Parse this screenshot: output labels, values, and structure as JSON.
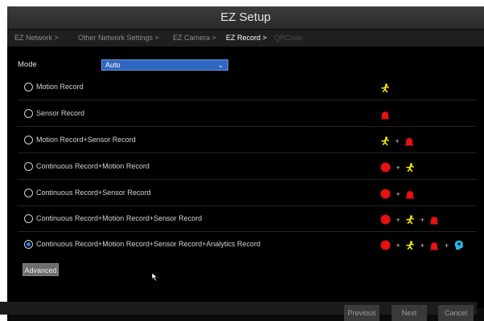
{
  "window": {
    "title": "EZ Setup"
  },
  "breadcrumb": {
    "items": [
      {
        "label": "EZ Network >",
        "state": "visited"
      },
      {
        "label": "Other Network Settings >",
        "state": "visited"
      },
      {
        "label": "EZ Camera >",
        "state": "visited"
      },
      {
        "label": "EZ Record >",
        "state": "active"
      },
      {
        "label": "QRCode",
        "state": "disabled"
      }
    ]
  },
  "mode": {
    "label": "Mode",
    "value": "Auto"
  },
  "options": [
    {
      "label": "Motion Record",
      "selected": false,
      "icons": [
        "motion"
      ]
    },
    {
      "label": "Sensor Record",
      "selected": false,
      "icons": [
        "sensor"
      ]
    },
    {
      "label": "Motion Record+Sensor Record",
      "selected": false,
      "icons": [
        "motion",
        "sensor"
      ]
    },
    {
      "label": "Continuous Record+Motion Record",
      "selected": false,
      "icons": [
        "continuous",
        "motion"
      ]
    },
    {
      "label": "Continuous Record+Sensor Record",
      "selected": false,
      "icons": [
        "continuous",
        "sensor"
      ]
    },
    {
      "label": "Continuous Record+Motion Record+Sensor Record",
      "selected": false,
      "icons": [
        "continuous",
        "motion",
        "sensor"
      ]
    },
    {
      "label": "Continuous Record+Motion Record+Sensor Record+Analytics Record",
      "selected": true,
      "icons": [
        "continuous",
        "motion",
        "sensor",
        "analytics"
      ]
    }
  ],
  "plus_symbol": "+",
  "advanced_label": "Advanced",
  "footer": {
    "previous": "Previous",
    "next": "Next",
    "cancel": "Cancel"
  },
  "colors": {
    "motion": "#f2e600",
    "sensor": "#e81010",
    "continuous": "#e81010",
    "analytics": "#22b8e6",
    "select_bg": "#2f66bf",
    "radio_selected": "#2a7ff0"
  }
}
